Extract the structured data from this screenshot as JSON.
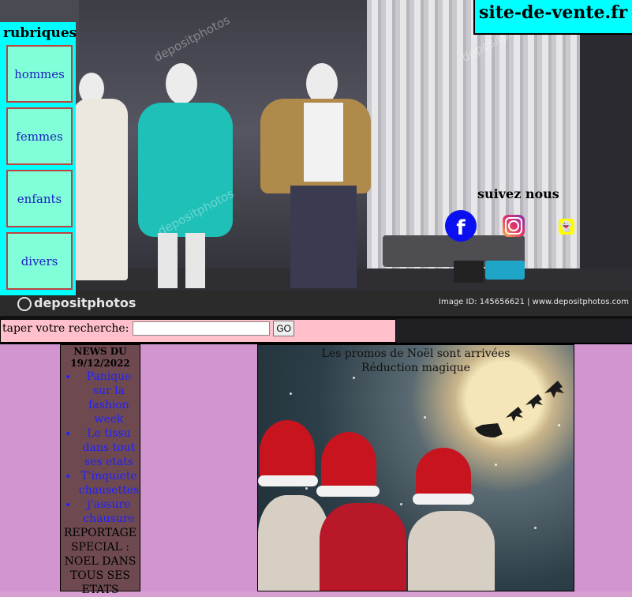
{
  "header": {
    "site_title": "site-de-vente.fr"
  },
  "rubriques": {
    "title": "rubriques",
    "items": [
      "hommes",
      "femmes",
      "enfants",
      "divers"
    ]
  },
  "hero": {
    "watermark_logo": "depositphotos",
    "watermark_info": "Image ID: 145656621  |  www.depositphotos.com",
    "faint_watermark": "depositphotos"
  },
  "social": {
    "title": "suivez nous",
    "icons": [
      "facebook-icon",
      "instagram-icon",
      "snapchat-icon"
    ],
    "facebook_glyph": "f"
  },
  "search": {
    "label": "taper votre recherche:",
    "value": "",
    "button_label": "GO"
  },
  "news": {
    "title": "NEWS DU 19/12/2022",
    "items": [
      "Panique sur la fashion week",
      "Le tissu dans tout ses etats",
      "T'inquiete chausettes",
      "j'assure chausure"
    ],
    "reportage": "REPORTAGE SPECIAL : NOEL DANS TOUS SES ETATS"
  },
  "promo": {
    "line1": "Les promos de Noël sont arrivées",
    "line2": "Réduction magique"
  },
  "colors": {
    "accent_cyan": "#00ffff",
    "rubrique_bg": "#80ffd8",
    "search_bg": "#ffc0cb",
    "page_bg": "#d295d0",
    "news_bg": "#6e4a50",
    "link": "#2020ff"
  }
}
